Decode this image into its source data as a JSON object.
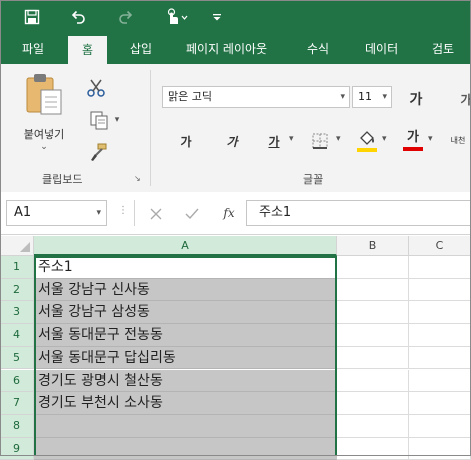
{
  "tabs": [
    "파일",
    "홈",
    "삽입",
    "페이지 레이아웃",
    "수식",
    "데이터",
    "검토"
  ],
  "active_tab": "홈",
  "colors": {
    "brand": "#217346",
    "selection": "#c6c6c6",
    "header_selected": "#d2ead9",
    "fill_yellow": "#ffd400",
    "font_red": "#e00000"
  },
  "quick_access": {
    "icons": [
      "save-icon",
      "undo-icon",
      "redo-icon",
      "touch-mode-icon",
      "customize-qat-icon"
    ]
  },
  "ribbon": {
    "clipboard": {
      "paste_label": "붙여넣기",
      "group_label": "클립보드"
    },
    "font": {
      "name": "맑은 고딕",
      "size": "11",
      "bold": "가",
      "italic": "가",
      "underline": "가",
      "grow_font": "가",
      "font_color_label": "가",
      "group_label": "글꼴",
      "extra_label": "내천"
    }
  },
  "formula_bar": {
    "name_box": "A1",
    "fx_label": "fx",
    "content": "주소1"
  },
  "grid": {
    "columns": [
      "A",
      "B",
      "C"
    ],
    "row_numbers": [
      "1",
      "2",
      "3",
      "4",
      "5",
      "6",
      "7",
      "8",
      "9"
    ],
    "cells_A": [
      "주소1",
      "서울 강남구 신사동",
      "서울 강남구 삼성동",
      "서울 동대문구 전농동",
      "서울 동대문구 답십리동",
      "경기도 광명시 철산동",
      "경기도 부천시 소사동",
      "",
      ""
    ]
  }
}
